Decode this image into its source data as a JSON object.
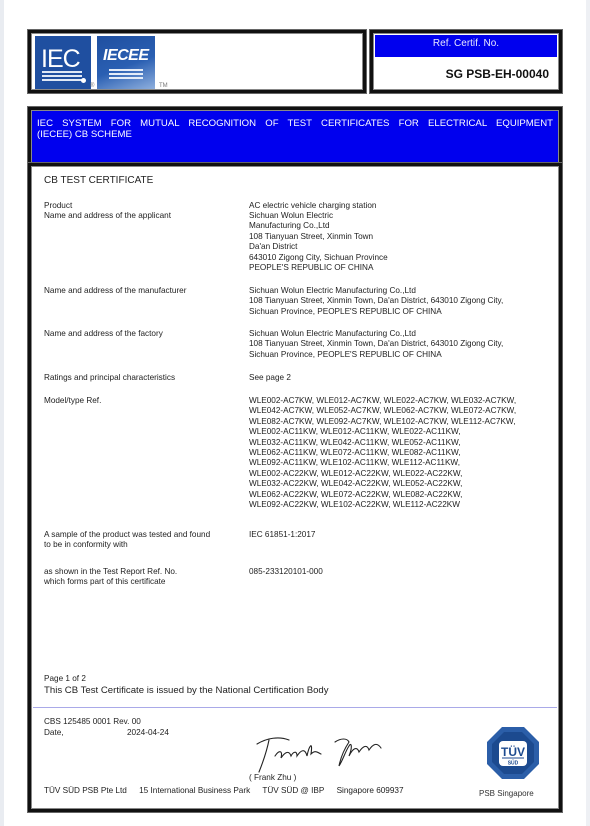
{
  "header": {
    "logos": [
      {
        "name": "IEC",
        "text": "IEC",
        "icon": "iec-logo"
      },
      {
        "name": "IECEE",
        "text": "IECEE",
        "icon": "iecee-logo"
      }
    ],
    "registered_mark": "®",
    "trademark": "TM",
    "ref_label": "Ref. Certif. No.",
    "ref_number": "SG PSB-EH-00040"
  },
  "banner": {
    "line1": "IEC SYSTEM FOR MUTUAL RECOGNITION OF TEST CERTIFICATES FOR ELECTRICAL EQUIPMENT",
    "line2": "(IECEE) CB SCHEME"
  },
  "certificate": {
    "title": "CB TEST CERTIFICATE",
    "fields": [
      {
        "label": [
          "Product"
        ],
        "value": [
          "AC electric vehicle charging station"
        ]
      },
      {
        "label": [
          "Name and address of the applicant"
        ],
        "value": [
          "Sichuan Wolun Electric",
          "Manufacturing Co.,Ltd",
          "108 Tianyuan Street, Xinmin Town",
          "Da'an District",
          "643010 Zigong City, Sichuan Province",
          "PEOPLE'S REPUBLIC OF CHINA"
        ]
      },
      {
        "label": [
          "Name and address of the manufacturer"
        ],
        "value": [
          "Sichuan Wolun Electric Manufacturing Co.,Ltd",
          "108 Tianyuan Street, Xinmin Town, Da'an District, 643010 Zigong City,",
          "Sichuan Province, PEOPLE'S REPUBLIC OF CHINA"
        ]
      },
      {
        "label": [
          "Name and address of the factory"
        ],
        "value": [
          "Sichuan Wolun Electric Manufacturing Co.,Ltd",
          "108 Tianyuan Street, Xinmin Town, Da'an District, 643010 Zigong City,",
          "Sichuan Province, PEOPLE'S REPUBLIC OF CHINA"
        ]
      },
      {
        "label": [
          "Ratings and principal characteristics"
        ],
        "value": [
          "See page 2"
        ]
      },
      {
        "label": [
          "Model/type Ref."
        ],
        "value": [
          "WLE002-AC7KW, WLE012-AC7KW, WLE022-AC7KW, WLE032-AC7KW,",
          "WLE042-AC7KW, WLE052-AC7KW, WLE062-AC7KW, WLE072-AC7KW,",
          "WLE082-AC7KW, WLE092-AC7KW, WLE102-AC7KW, WLE112-AC7KW,",
          "WLE002-AC11KW, WLE012-AC11KW, WLE022-AC11KW,",
          "WLE032-AC11KW, WLE042-AC11KW, WLE052-AC11KW,",
          "WLE062-AC11KW, WLE072-AC11KW, WLE082-AC11KW,",
          "WLE092-AC11KW, WLE102-AC11KW, WLE112-AC11KW,",
          "WLE002-AC22KW, WLE012-AC22KW, WLE022-AC22KW,",
          "WLE032-AC22KW, WLE042-AC22KW, WLE052-AC22KW,",
          "WLE062-AC22KW, WLE072-AC22KW, WLE082-AC22KW,",
          "WLE092-AC22KW, WLE102-AC22KW, WLE112-AC22KW"
        ]
      },
      {
        "label": [
          "A sample of the product was tested and found",
          "to be in conformity with"
        ],
        "value": [
          "IEC 61851-1:2017"
        ]
      },
      {
        "label": [
          "as shown in the Test Report Ref. No.",
          "which forms part of this certificate"
        ],
        "value": [
          "085-233120101-000"
        ]
      }
    ],
    "page": "Page 1 of 2",
    "issued_by": "This CB Test Certificate is issued by the National Certification Body"
  },
  "footer": {
    "ref_code": "CBS 125485 0001 Rev. 00",
    "date_label": "Date,",
    "date_value": "2024-04-24",
    "signature_name": "( Frank Zhu )",
    "address": [
      "TÜV SÜD PSB Pte Ltd",
      "15 International Business Park",
      "TÜV SÜD @ IBP",
      "Singapore 609937"
    ],
    "logo_text": "TÜV",
    "logo_subtext": "SÜD",
    "logo_caption": "PSB Singapore"
  },
  "colors": {
    "banner_blue": "#0000ee",
    "logo_blue": "#1f4fa0",
    "tuv_blue": "#2b5ea8"
  }
}
